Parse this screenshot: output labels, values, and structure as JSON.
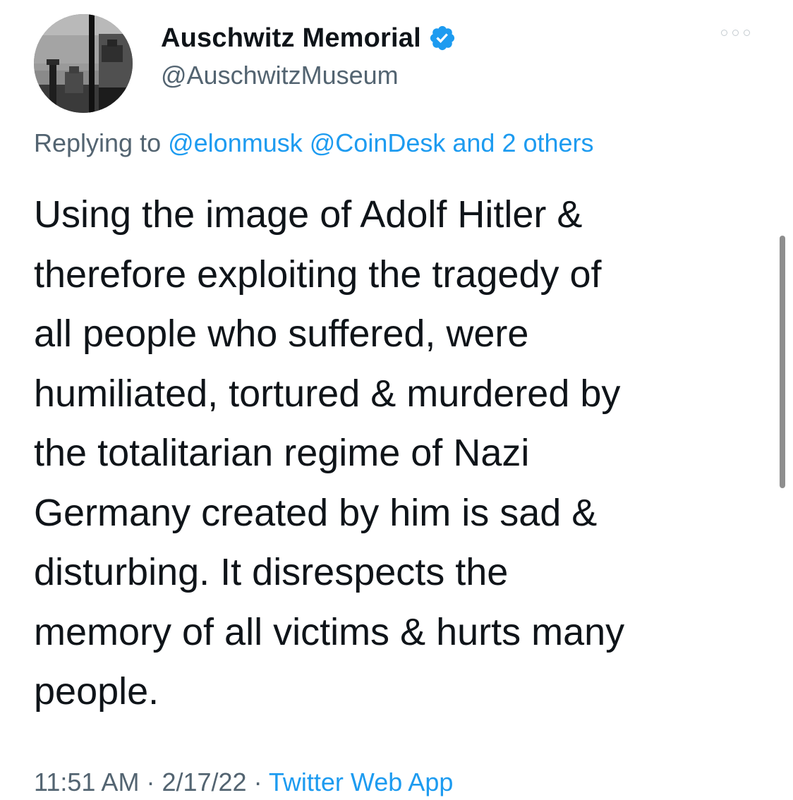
{
  "author": {
    "display_name": "Auschwitz Memorial",
    "handle": "@AuschwitzMuseum",
    "verified": true,
    "verified_icon": "verified-badge-icon",
    "verified_color": "#1d9bf0"
  },
  "reply": {
    "prefix": "Replying to ",
    "mention_1": "@elonmusk",
    "mention_2": "@CoinDesk",
    "rest": "and 2 others"
  },
  "body": {
    "lines": [
      "Using the image of Adolf Hitler &",
      "therefore exploiting the tragedy of",
      "all people who suffered, were",
      "humiliated, tortured & murdered by",
      "the totalitarian regime of Nazi",
      "Germany created by him is sad &",
      "disturbing. It disrespects the",
      "memory of all victims & hurts many",
      "people."
    ]
  },
  "meta": {
    "time": "11:51 AM",
    "separator": " · ",
    "date": "2/17/22",
    "source": "Twitter Web App"
  },
  "colors": {
    "text": "#0f1419",
    "secondary": "#536471",
    "link": "#1d9bf0"
  },
  "icons": {
    "more": "more-options-icon"
  }
}
